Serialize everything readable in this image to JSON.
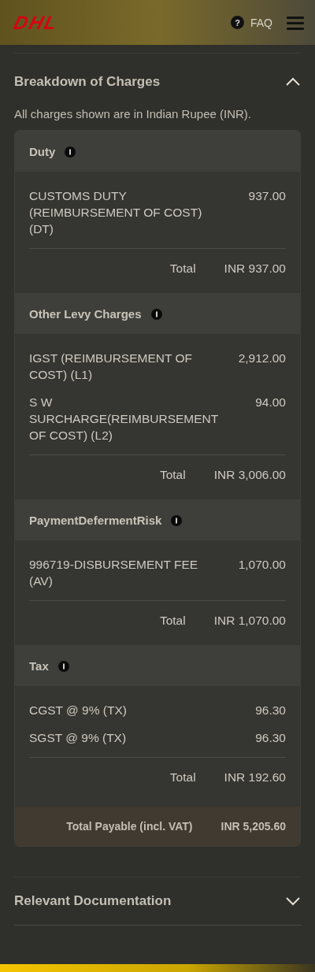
{
  "header": {
    "logo": "DHL",
    "help_glyph": "?",
    "help": "FAQ"
  },
  "sections": [
    {
      "title": "Breakdown of Charges",
      "expanded": true,
      "note": "All charges shown are in Indian Rupee (INR).",
      "groups": [
        {
          "title": "Duty",
          "items": [
            {
              "label": "CUSTOMS DUTY (REIMBURSEMENT OF COST) (DT)",
              "amount": "937.00"
            }
          ],
          "total_label": "Total",
          "total": "INR 937.00"
        },
        {
          "title": "Other Levy Charges",
          "items": [
            {
              "label": "IGST (REIMBURSEMENT OF COST) (L1)",
              "amount": "2,912.00"
            },
            {
              "label": "S W SURCHARGE(REIMBURSEMENT OF COST) (L2)",
              "amount": "94.00"
            }
          ],
          "total_label": "Total",
          "total": "INR 3,006.00"
        },
        {
          "title": "PaymentDefermentRisk",
          "items": [
            {
              "label": "996719-DISBURSEMENT FEE (AV)",
              "amount": "1,070.00"
            }
          ],
          "total_label": "Total",
          "total": "INR 1,070.00"
        },
        {
          "title": "Tax",
          "items": [
            {
              "label": "CGST @ 9% (TX)",
              "amount": "96.30"
            },
            {
              "label": "SGST @ 9% (TX)",
              "amount": "96.30"
            }
          ],
          "total_label": "Total",
          "total": "INR 192.60"
        }
      ],
      "grand_label": "Total Payable (incl. VAT)",
      "grand_total": "INR 5,205.60"
    },
    {
      "title": "Relevant Documentation",
      "expanded": false
    }
  ]
}
